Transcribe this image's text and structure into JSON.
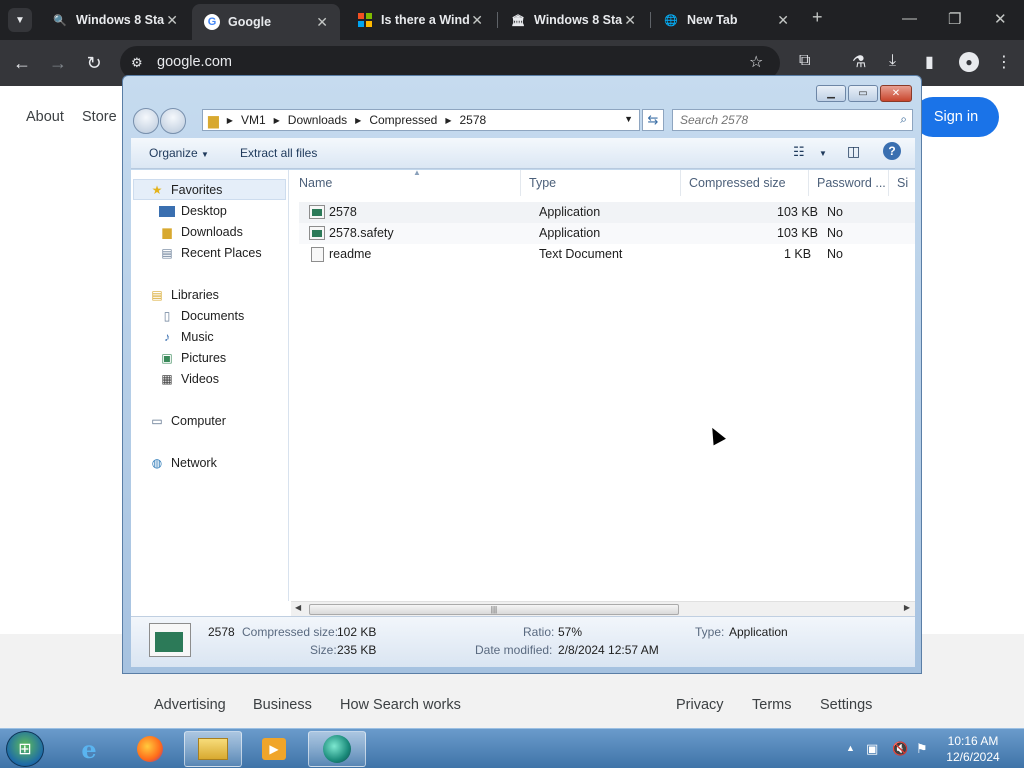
{
  "browser": {
    "tabs": [
      {
        "title": "Windows 8 Sta",
        "icon": "search-icon"
      },
      {
        "title": "Google",
        "icon": "google-icon",
        "active": true
      },
      {
        "title": "Is there a Wind",
        "icon": "windows-logo-icon"
      },
      {
        "title": "Windows 8 Sta",
        "icon": "bank-icon"
      },
      {
        "title": "New Tab",
        "icon": "globe-icon"
      }
    ],
    "url": "google.com"
  },
  "google": {
    "header_links": [
      "About",
      "Store"
    ],
    "signin_label": "Sign in",
    "footer_left": [
      "Advertising",
      "Business",
      "How Search works"
    ],
    "footer_right": [
      "Privacy",
      "Terms",
      "Settings"
    ]
  },
  "explorer": {
    "breadcrumb": [
      "VM1",
      "Downloads",
      "Compressed",
      "2578"
    ],
    "search_placeholder": "Search 2578",
    "commands": {
      "organize": "Organize",
      "extract": "Extract all files"
    },
    "nav": {
      "favorites": "Favorites",
      "favorites_items": [
        "Desktop",
        "Downloads",
        "Recent Places"
      ],
      "libraries": "Libraries",
      "libraries_items": [
        "Documents",
        "Music",
        "Pictures",
        "Videos"
      ],
      "computer": "Computer",
      "network": "Network"
    },
    "columns": [
      "Name",
      "Type",
      "Compressed size",
      "Password ...",
      "Si"
    ],
    "files": [
      {
        "name": "2578",
        "type": "Application",
        "size": "103 KB",
        "password": "No",
        "icon": "application-icon"
      },
      {
        "name": "2578.safety",
        "type": "Application",
        "size": "103 KB",
        "password": "No",
        "icon": "application-icon"
      },
      {
        "name": "readme",
        "type": "Text Document",
        "size": "1 KB",
        "password": "No",
        "icon": "text-document-icon"
      }
    ],
    "details": {
      "name": "2578",
      "compressed_size_label": "Compressed size:",
      "compressed_size": "102 KB",
      "size_label": "Size:",
      "size": "235 KB",
      "ratio_label": "Ratio:",
      "ratio": "57%",
      "date_label": "Date modified:",
      "date": "2/8/2024 12:57 AM",
      "type_label": "Type:",
      "type": "Application"
    }
  },
  "taskbar": {
    "time": "10:16 AM",
    "date": "12/6/2024"
  }
}
